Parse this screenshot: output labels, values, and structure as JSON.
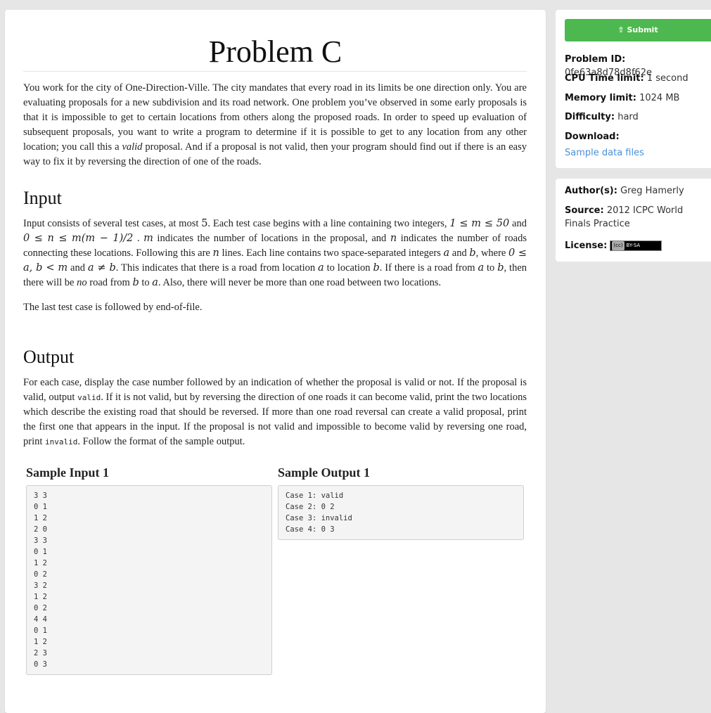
{
  "problem": {
    "title": "Problem C",
    "statement_intro": "You work for the city of One-Direction-Ville. The city mandates that every road in its limits be one direction only. You are evaluating proposals for a new subdivision and its road network. One problem you’ve observed in some early proposals is that it is impossible to get to certain locations from others along the proposed roads. In order to speed up evaluation of subsequent proposals, you want to write a program to determine if it is possible to get to any location from any other location; you call this a ",
    "statement_valid_word": "valid",
    "statement_end": " proposal. And if a proposal is not valid, then your program should find out if there is an easy way to fix it by reversing the direction of one of the roads.",
    "input_heading": "Input",
    "input_p1": {
      "a": "Input consists of several test cases, at most ",
      "max_cases": "5",
      "b": ". Each test case begins with a line containing two integers, ",
      "m_range": "1 ≤ m ≤ 50",
      "c": " and ",
      "n_range": "0 ≤ n ≤ m(m − 1)/2",
      "d": " . ",
      "m": "m",
      "e": " indicates the number of locations in the proposal, and ",
      "n": "n",
      "f": " indicates the number of roads connecting these locations. Following this are ",
      "n2": "n",
      "g": " lines. Each line contains two space-separated integers ",
      "a_var": "a",
      "h": " and ",
      "b_var": "b",
      "i": ", where ",
      "ab_range": "0 ≤ a, b < m",
      "j": " and ",
      "ab_ne": "a ≠ b",
      "k": ". This indicates that there is a road from location ",
      "a2": "a",
      "l": " to location ",
      "b2": "b",
      "m_text": ". If there is a road from ",
      "a3": "a",
      "n_text": " to ",
      "b3": "b",
      "o": ", then there will be ",
      "no": "no",
      "p": " road from ",
      "b4": "b",
      "q": " to ",
      "a4": "a",
      "r": ". Also, there will never be more than one road between two locations."
    },
    "input_p2": "The last test case is followed by end-of-file.",
    "output_heading": "Output",
    "output_p": {
      "a": "For each case, display the case number followed by an indication of whether the proposal is valid or not. If the proposal is valid, output ",
      "valid_code": "valid",
      "b": ". If it is not valid, but by reversing the direction of one roads it can become valid, print the two locations which describe the existing road that should be reversed. If more than one road reversal can create a valid proposal, print the first one that appears in the input. If the proposal is not valid and impossible to become valid by reversing one road, print ",
      "invalid_code": "invalid",
      "c": ". Follow the format of the sample output."
    },
    "sample_input_heading": "Sample Input 1",
    "sample_output_heading": "Sample Output 1",
    "sample_input_lines": [
      "3 3",
      "0 1",
      "1 2",
      "2 0",
      "3 3",
      "0 1",
      "1 2",
      "0 2",
      "3 2",
      "1 2",
      "0 2",
      "4 4",
      "0 1",
      "1 2",
      "2 3",
      "0 3"
    ],
    "sample_output_lines": [
      "Case 1: valid",
      "Case 2: 0 2",
      "Case 3: invalid",
      "Case 4: 0 3"
    ]
  },
  "sidebar": {
    "submit_label": "Submit",
    "problem_id_label": "Problem ID:",
    "problem_id": "0fe63a8d78d8f62e",
    "cpu_label": "CPU Time limit:",
    "cpu_value": "1 second",
    "memory_label": "Memory limit:",
    "memory_value": "1024 MB",
    "difficulty_label": "Difficulty:",
    "difficulty_value": "hard",
    "download_label": "Download:",
    "download_link": "Sample data files",
    "authors_label": "Author(s):",
    "authors_value": "Greg Hamerly",
    "source_label": "Source:",
    "source_value": "2012 ICPC World Finals Practice",
    "license_label": "License:",
    "license_badge_cc": "(cc)",
    "license_badge_text": "BY-SA",
    "submit_color": "#4cb84f",
    "link_color": "#4a90d9"
  }
}
